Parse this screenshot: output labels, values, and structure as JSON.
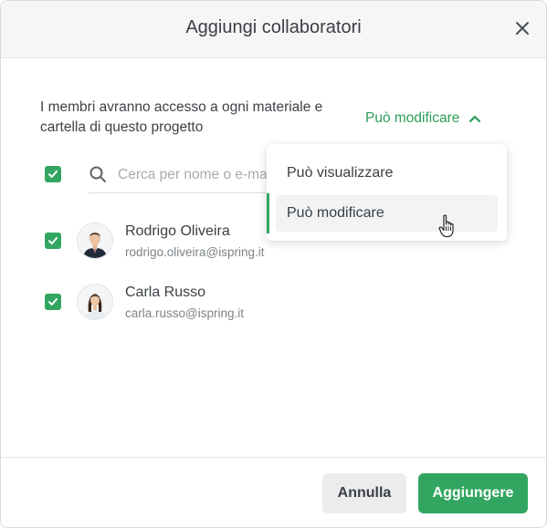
{
  "dialog": {
    "title": "Aggiungi collaboratori",
    "close_icon": "close-icon"
  },
  "description": "I membri avranno accesso a ogni materiale e cartella di questo progetto",
  "permission": {
    "selected": "Può modificare",
    "icon": "chevron-up-icon",
    "options": [
      {
        "label": "Può visualizzare"
      },
      {
        "label": "Può modificare"
      }
    ]
  },
  "search": {
    "placeholder": "Cerca per nome o e-mail",
    "value": "",
    "icon": "search-icon"
  },
  "members": [
    {
      "name": "Rodrigo Oliveira",
      "email": "rodrigo.oliveira@ispring.it",
      "checked": true
    },
    {
      "name": "Carla Russo",
      "email": "carla.russo@ispring.it",
      "checked": true
    }
  ],
  "footer": {
    "cancel_label": "Annulla",
    "add_label": "Aggiungere"
  },
  "colors": {
    "accent": "#32a661",
    "accent_text": "#2e9e58",
    "header_bg": "#f6f6f7"
  }
}
